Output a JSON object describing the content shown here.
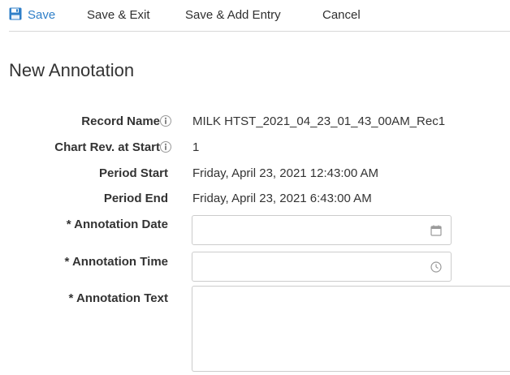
{
  "toolbar": {
    "save_label": "Save",
    "save_exit_label": "Save & Exit",
    "save_add_label": "Save & Add Entry",
    "cancel_label": "Cancel"
  },
  "page": {
    "title": "New Annotation"
  },
  "form": {
    "record_name": {
      "label": "Record Name",
      "value": "MILK HTST_2021_04_23_01_43_00AM_Rec1"
    },
    "chart_rev": {
      "label": "Chart Rev. at Start",
      "value": "1"
    },
    "period_start": {
      "label": "Period Start",
      "value": "Friday, April 23, 2021 12:43:00 AM"
    },
    "period_end": {
      "label": "Period End",
      "value": "Friday, April 23, 2021 6:43:00 AM"
    },
    "annotation_date": {
      "label": "* Annotation Date",
      "value": ""
    },
    "annotation_time": {
      "label": "* Annotation Time",
      "value": ""
    },
    "annotation_text": {
      "label": "* Annotation Text",
      "value": ""
    }
  },
  "icons": {
    "save": "floppy-disk-icon",
    "info": "info-icon",
    "calendar": "calendar-icon",
    "clock": "clock-icon"
  },
  "colors": {
    "accent": "#2f7fc8",
    "border": "#cccccc",
    "divider": "#d7d7d7",
    "text": "#333333",
    "icon": "#9a9a9a"
  }
}
